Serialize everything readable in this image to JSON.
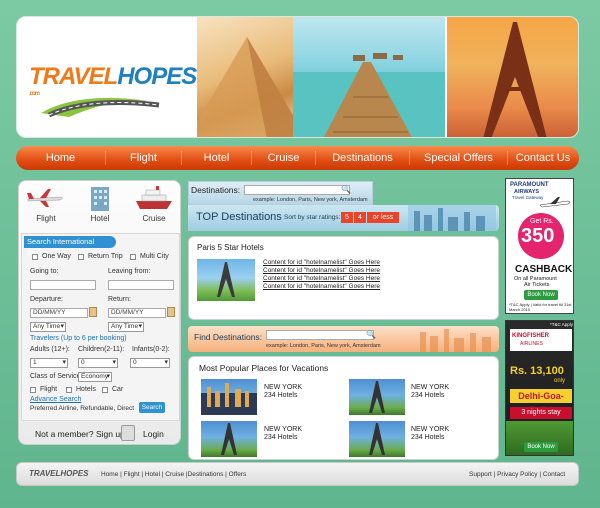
{
  "brand": {
    "name_part1": "TRAVEL",
    "name_part2": "HOPES",
    "tld": ".com"
  },
  "nav": [
    "Home",
    "Flight",
    "Hotel",
    "Cruise",
    "Destinations",
    "Special Offers",
    "Contact Us"
  ],
  "panel_tabs": [
    "Flight",
    "Hotel",
    "Cruise"
  ],
  "search": {
    "title": "Search International Flights",
    "trip_types": [
      "One Way",
      "Return Trip",
      "Multi City"
    ],
    "going_to": "Going to:",
    "leaving_from": "Leaving from:",
    "departure": "Departure:",
    "return": "Return:",
    "date_placeholder": "DD/MM/YY",
    "time_value": "Any Time",
    "travelers_note": "Travelers (Up to 6 per booking)",
    "adults": "Adults (12+):",
    "children": "Children(2-11):",
    "infants": "Infants(0-2):",
    "adults_val": "1",
    "children_val": "0",
    "infants_val": "0",
    "class_label": "Class of Service",
    "class_val": "Economy",
    "filters": [
      "Flight",
      "Hotels",
      "Car"
    ],
    "advance": "Advance Search",
    "preferred": "Preferred Airline, Refundable, Direct",
    "button": "Search"
  },
  "member": {
    "prompt": "Not a member? Sign up",
    "login": "Login"
  },
  "destinations": {
    "label": "Destinations:",
    "example": "example: London, Paris, New york, Amsterdam"
  },
  "top_dest": {
    "title": "TOP Destinations",
    "sort": "Sort by star ratings:",
    "stars5": "5",
    "stars4": "4",
    "less": "or less"
  },
  "paris_box": {
    "title": "Paris 5 Star Hotels",
    "lines": [
      "Content for id \"hotelnamelist\" Goes Here",
      "Content for id \"hotelnamelist\" Goes Here",
      "Content for id \"hotelnamelist\" Goes Here",
      "Content for id \"hotelnamelist\" Goes Here"
    ]
  },
  "find": {
    "label": "Find Destinations:",
    "example": "example: London, Paris, New york, Amsterdam"
  },
  "popular": {
    "title": "Most Popular Places for Vacations",
    "items": [
      {
        "city": "NEW YORK",
        "hotels": "234 Hotels"
      },
      {
        "city": "NEW YORK",
        "hotels": "234 Hotels"
      },
      {
        "city": "NEW YORK",
        "hotels": "234 Hotels"
      },
      {
        "city": "NEW YORK",
        "hotels": "234 Hotels"
      }
    ]
  },
  "ad1": {
    "brand": "PARAMOUNT",
    "brand2": "AIRWAYS",
    "brand3": "Travel Gateway",
    "getrs": "Get Rs.",
    "amount": "350",
    "cashback": "CASHBACK",
    "on": "On all Paramount",
    "air": "Air Tickets",
    "book": "Book Now",
    "tc": "*T&C Apply | Valid for travel till 31st March 2010"
  },
  "ad2": {
    "tc": "*T&C Apply",
    "brand": "KINGFISHER",
    "brand2": "AIRLINES",
    "price": "Rs. 13,100",
    "only": "only",
    "route": "Delhi-Goa-Delhi",
    "stay": "3 nights stay",
    "book": "Book Now"
  },
  "footer": {
    "left_links": "Home | Flight | Hotel | Cruise |Destinations | Offers",
    "right_links": "Support | Privacy Policy | Contact",
    "brand": "TRAVELHOPES"
  }
}
